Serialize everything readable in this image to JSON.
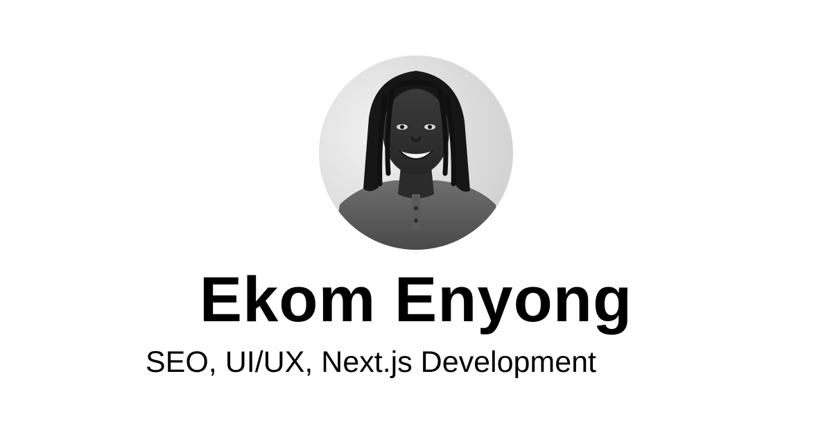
{
  "profile": {
    "name": "Ekom Enyong",
    "tagline": "SEO, UI/UX, Next.js Development"
  },
  "avatar": {
    "icon": "profile-photo"
  },
  "colors": {
    "background": "#ffffff",
    "text": "#000000"
  }
}
